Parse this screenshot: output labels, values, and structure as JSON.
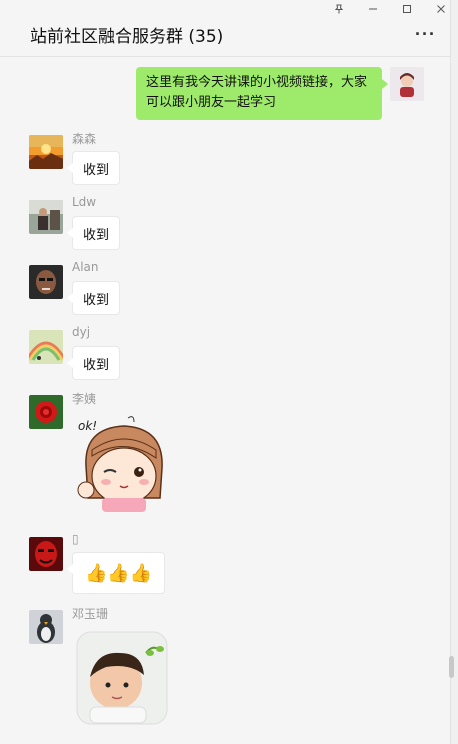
{
  "window": {
    "pin_icon": "pin-icon",
    "minimize_icon": "minimize-icon",
    "maximize_icon": "maximize-icon",
    "close_icon": "close-icon"
  },
  "header": {
    "title": "站前社区融合服务群 (35)",
    "more_label": "···"
  },
  "self_message": {
    "text": "这里有我今天讲课的小视频链接，大家可以跟小朋友一起学习"
  },
  "messages": [
    {
      "sender": "森森",
      "text": "收到"
    },
    {
      "sender": "Ldw",
      "text": "收到"
    },
    {
      "sender": "Alan",
      "text": "收到"
    },
    {
      "sender": "dyj",
      "text": "收到"
    },
    {
      "sender": "李姨",
      "sticker": "ok-girl-sticker"
    },
    {
      "sender": "▯",
      "text": "👍👍👍"
    },
    {
      "sender": "邓玉珊",
      "sticker": "boy-photo-sticker"
    }
  ],
  "colors": {
    "self_bubble": "#9eea6a",
    "other_bubble": "#ffffff",
    "background": "#f5f5f5"
  }
}
